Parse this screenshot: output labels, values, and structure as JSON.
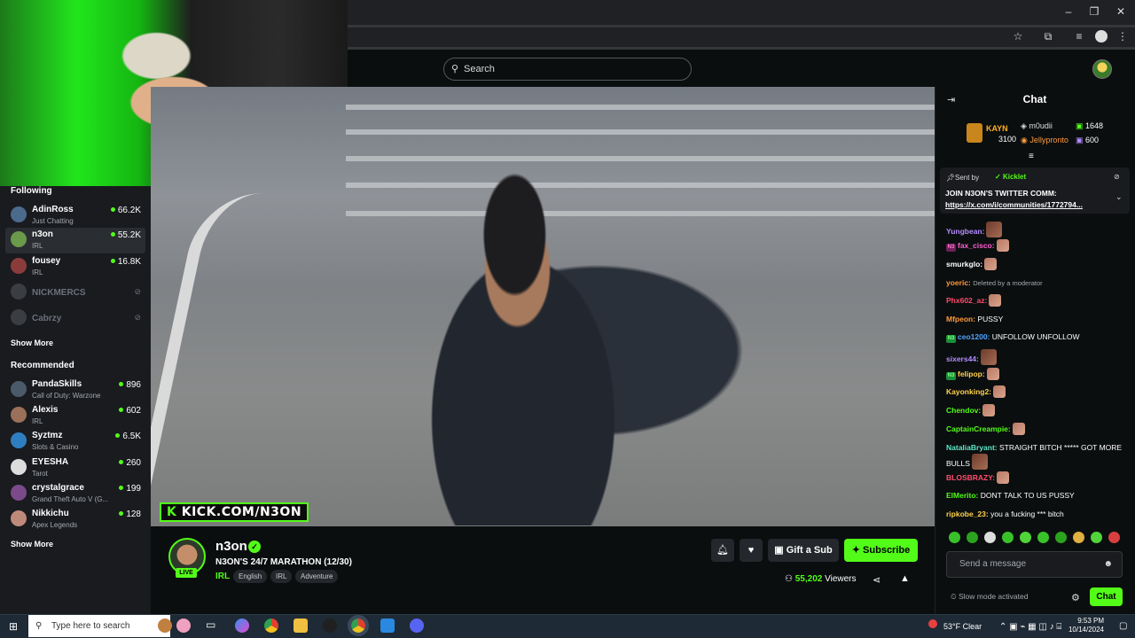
{
  "search": {
    "placeholder": "Search"
  },
  "sidebar": {
    "following_title": "Following",
    "following": [
      {
        "name": "AdinRoss",
        "category": "Just Chatting",
        "viewers": "66.2K",
        "live": true
      },
      {
        "name": "n3on",
        "category": "IRL",
        "viewers": "55.2K",
        "live": true,
        "active": true
      },
      {
        "name": "fousey",
        "category": "IRL",
        "viewers": "16.8K",
        "live": true
      },
      {
        "name": "NICKMERCS",
        "category": "",
        "viewers": "",
        "live": false
      },
      {
        "name": "Cabrzy",
        "category": "",
        "viewers": "",
        "live": false
      }
    ],
    "show_more": "Show More",
    "recommended_title": "Recommended",
    "recommended": [
      {
        "name": "PandaSkills",
        "category": "Call of Duty: Warzone",
        "viewers": "896"
      },
      {
        "name": "Alexis",
        "category": "IRL",
        "viewers": "602"
      },
      {
        "name": "Syztmz",
        "category": "Slots & Casino",
        "viewers": "6.5K"
      },
      {
        "name": "EYESHA",
        "category": "Tarot",
        "viewers": "260"
      },
      {
        "name": "crystalgrace",
        "category": "Grand Theft Auto V (G...",
        "viewers": "199"
      },
      {
        "name": "Nikkichu",
        "category": "Apex Legends",
        "viewers": "128"
      }
    ]
  },
  "video": {
    "watermark_k": "K",
    "watermark_text": "KICK.COM/N3ON"
  },
  "stream": {
    "channel": "n3on",
    "live_label": "LIVE",
    "title": "N3ON'S 24/7 MARATHON (12/30)",
    "category": "IRL",
    "tags": [
      "English",
      "IRL",
      "Adventure"
    ],
    "gift_label": "Gift a Sub",
    "subscribe_label": "Subscribe",
    "viewers_count": "55,202",
    "viewers_label": "Viewers"
  },
  "chat": {
    "title": "Chat",
    "leaderboard": [
      {
        "name": "KAYN",
        "value": "3100"
      },
      {
        "name": "m0udii",
        "value": "1648"
      },
      {
        "name": "Jellypronto",
        "value": "600"
      }
    ],
    "pinned": {
      "sent_by_label": "Sent by",
      "sender": "Kicklet",
      "text": "JOIN N3ON'S TWITTER COMM:",
      "link": "https://x.com/i/communities/1772794..."
    },
    "messages": [
      {
        "user": "Yungbean:",
        "color": "#b38cff",
        "text": "",
        "emote": "big"
      },
      {
        "user": "fax_cisco:",
        "color": "#ff5ecf",
        "text": "",
        "emote": "small",
        "badge": "pink"
      },
      {
        "user": "smurkglo:",
        "color": "#ffffff",
        "text": "",
        "emote": "small"
      },
      {
        "user": "yoeric:",
        "color": "#ff9a3c",
        "text": "Deleted by a moderator",
        "deleted": true
      },
      {
        "user": "Phx602_az:",
        "color": "#ff4d6d",
        "text": "",
        "emote": "small"
      },
      {
        "user": "Mfpeon:",
        "color": "#ff9a3c",
        "text": "PUSSY"
      },
      {
        "user": "ceo1200:",
        "color": "#4fa3ff",
        "text": "UNFOLLOW UNFOLLOW",
        "badge": "green"
      },
      {
        "user": "sixers44:",
        "color": "#b38cff",
        "text": "",
        "emote": "big"
      },
      {
        "user": "felipop:",
        "color": "#ffd24d",
        "text": "",
        "emote": "small",
        "badge": "green"
      },
      {
        "user": "Kayonking2:",
        "color": "#ffd24d",
        "text": "",
        "emote": "small"
      },
      {
        "user": "Chendov:",
        "color": "#53fc18",
        "text": "",
        "emote": "small"
      },
      {
        "user": "CaptainCreampie:",
        "color": "#53fc18",
        "text": "",
        "emote": "small"
      },
      {
        "user": "NataliaBryant:",
        "color": "#5ee6c8",
        "text": "STRAIGHT BITCH ***** GOT MORE BULLS",
        "emote": "big"
      },
      {
        "user": "BLOSBRAZY:",
        "color": "#ff4d6d",
        "text": "",
        "emote": "small"
      },
      {
        "user": "ElMerito:",
        "color": "#53fc18",
        "text": "DONT TALK TO US PUSSY"
      },
      {
        "user": "ripkobe_23:",
        "color": "#ffd24d",
        "text": "you a fucking *** bitch"
      }
    ],
    "input_placeholder": "Send a message",
    "slow_mode": "Slow mode activated",
    "send_label": "Chat"
  },
  "taskbar": {
    "search_placeholder": "Type here to search",
    "weather": "53°F  Clear",
    "time": "9:53 PM",
    "date": "10/14/2024"
  },
  "colors": {
    "accent": "#53fc18",
    "bg": "#0b0e0f",
    "panel": "#191b1f"
  }
}
